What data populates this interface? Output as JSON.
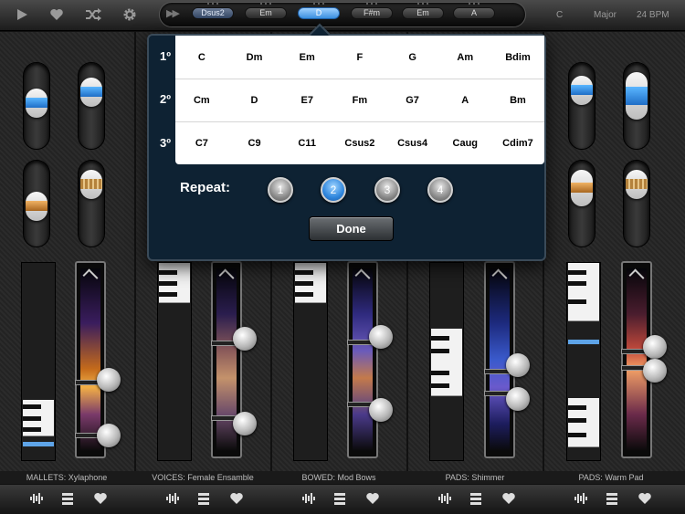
{
  "topbar": {
    "icons": {
      "play": "play-icon",
      "favorite": "heart-icon",
      "shuffle": "shuffle-icon",
      "settings": "gear-icon",
      "forward": "fast-forward-icon"
    },
    "chords": [
      {
        "label": "Dsus2",
        "state": "pending"
      },
      {
        "label": "Em",
        "state": "normal"
      },
      {
        "label": "D",
        "state": "active"
      },
      {
        "label": "F#m",
        "state": "normal"
      },
      {
        "label": "Em",
        "state": "normal"
      },
      {
        "label": "A",
        "state": "normal"
      }
    ],
    "key": "C",
    "scale": "Major",
    "tempo": "24 BPM"
  },
  "popover": {
    "rows": [
      {
        "label": "1º",
        "chords": [
          "C",
          "Dm",
          "Em",
          "F",
          "G",
          "Am",
          "Bdim"
        ]
      },
      {
        "label": "2º",
        "chords": [
          "Cm",
          "D",
          "E7",
          "Fm",
          "G7",
          "A",
          "Bm"
        ]
      },
      {
        "label": "3º",
        "chords": [
          "C7",
          "C9",
          "C11",
          "Csus2",
          "Csus4",
          "Caug",
          "Cdim7"
        ]
      }
    ],
    "repeat_label": "Repeat:",
    "repeat_options": [
      "1",
      "2",
      "3",
      "4"
    ],
    "repeat_selected": "2",
    "done_label": "Done"
  },
  "channels": [
    {
      "label": "MALLETS: Xylaphone"
    },
    {
      "label": "VOICES: Female Ensamble"
    },
    {
      "label": "BOWED: Mod Bows"
    },
    {
      "label": "PADS: Shimmer"
    },
    {
      "label": "PADS: Warm Pad"
    }
  ],
  "footer_icons": [
    "waveform-icon",
    "menu-icon",
    "heart-icon"
  ],
  "colors": {
    "accent_blue": "#3b8fe0",
    "popover_bg": "#0e2233"
  }
}
